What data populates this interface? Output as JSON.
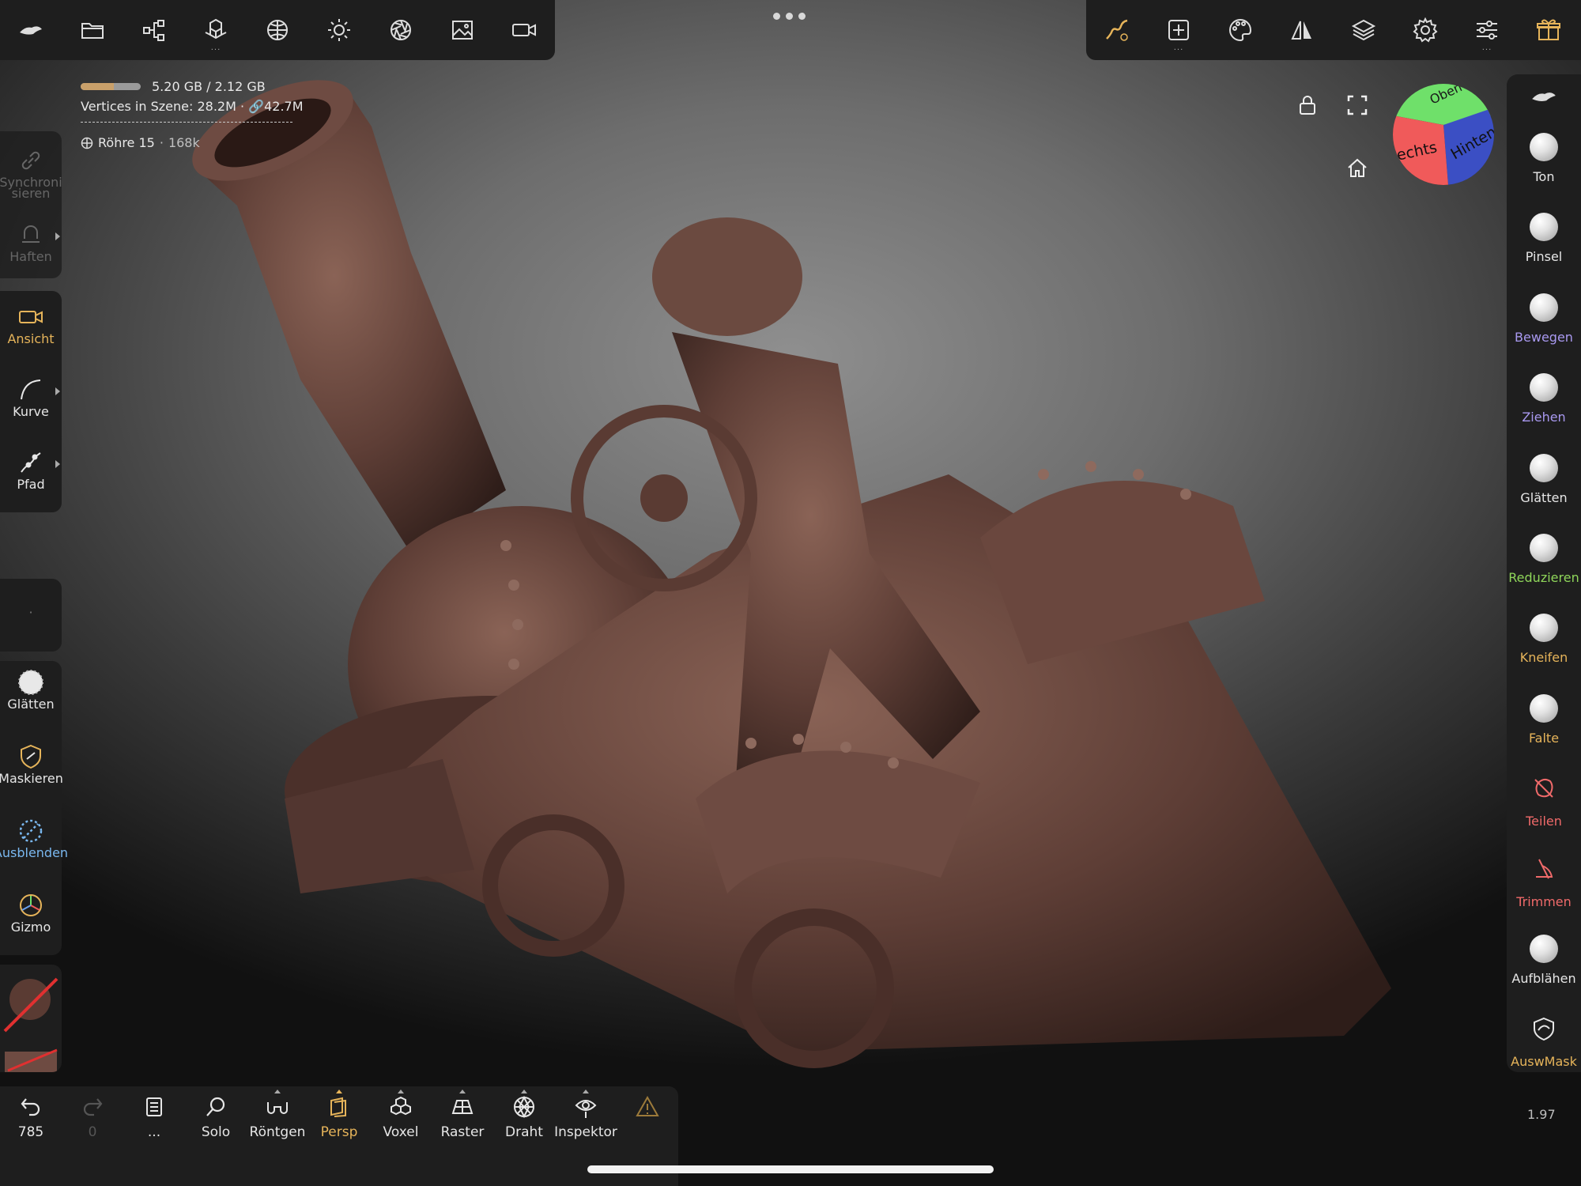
{
  "colors": {
    "panel": "#1e1e1e",
    "accent": "#e6b45a",
    "purple": "#a999f0",
    "green": "#8fd65a",
    "blue": "#7ab8f0",
    "text": "#e6e6e6"
  },
  "top_toolbar_left": [
    {
      "name": "nomad-logo-icon"
    },
    {
      "name": "folder-icon"
    },
    {
      "name": "scene-graph-icon"
    },
    {
      "name": "primitives-icon"
    },
    {
      "name": "material-sphere-icon"
    },
    {
      "name": "light-icon"
    },
    {
      "name": "camera-aperture-icon"
    },
    {
      "name": "image-icon"
    },
    {
      "name": "video-camera-icon"
    }
  ],
  "top_toolbar_right": [
    {
      "name": "stroke-settings-icon"
    },
    {
      "name": "tool-settings-icon"
    },
    {
      "name": "palette-icon"
    },
    {
      "name": "symmetry-icon"
    },
    {
      "name": "layers-icon"
    },
    {
      "name": "gear-icon"
    },
    {
      "name": "sliders-icon"
    },
    {
      "name": "gift-icon"
    }
  ],
  "info": {
    "memory": "5.20 GB / 2.12 GB",
    "memory_fill": 0.55,
    "vertices_label": "Vertices in Szene",
    "vertices_value": "28.2M",
    "vertices_linked": "42.7M",
    "object_name": "Röhre 15",
    "object_count": "168k"
  },
  "viewcube": {
    "top": "Oben",
    "right": "Hinten",
    "left": "Rechts"
  },
  "left_panel": {
    "sync_label": "Synchroni\nsieren",
    "stick_label": "Haften",
    "view_label": "Ansicht",
    "curve_label": "Kurve",
    "path_label": "Pfad",
    "dot": "·",
    "smooth_label": "Glätten",
    "mask_label": "Maskieren",
    "hide_label": "Ausblenden",
    "gizmo_label": "Gizmo"
  },
  "right_tools": [
    {
      "label": "Ton",
      "color": "#e6e6e6",
      "kind": "ball"
    },
    {
      "label": "Pinsel",
      "color": "#e6e6e6",
      "kind": "ball"
    },
    {
      "label": "Bewegen",
      "color": "#a999f0",
      "kind": "ball"
    },
    {
      "label": "Ziehen",
      "color": "#a999f0",
      "kind": "ball"
    },
    {
      "label": "Glätten",
      "color": "#e6e6e6",
      "kind": "ball"
    },
    {
      "label": "Reduzieren",
      "color": "#8fd65a",
      "kind": "ball"
    },
    {
      "label": "Kneifen",
      "color": "#e6b45a",
      "kind": "ball"
    },
    {
      "label": "Falte",
      "color": "#e6b45a",
      "kind": "ball"
    },
    {
      "label": "Teilen",
      "color": "#f06a6a",
      "kind": "icon"
    },
    {
      "label": "Trimmen",
      "color": "#f06a6a",
      "kind": "icon"
    },
    {
      "label": "Aufblähen",
      "color": "#e6e6e6",
      "kind": "ball"
    },
    {
      "label": "AuswMask",
      "color": "#e6b45a",
      "kind": "icon"
    }
  ],
  "bottom_bar": {
    "undo_count": "785",
    "redo_count": "0",
    "history_label": "...",
    "solo_label": "Solo",
    "xray_label": "Röntgen",
    "persp_label": "Persp",
    "voxel_label": "Voxel",
    "grid_label": "Raster",
    "wire_label": "Draht",
    "inspector_label": "Inspektor"
  },
  "zoom": "1.97"
}
